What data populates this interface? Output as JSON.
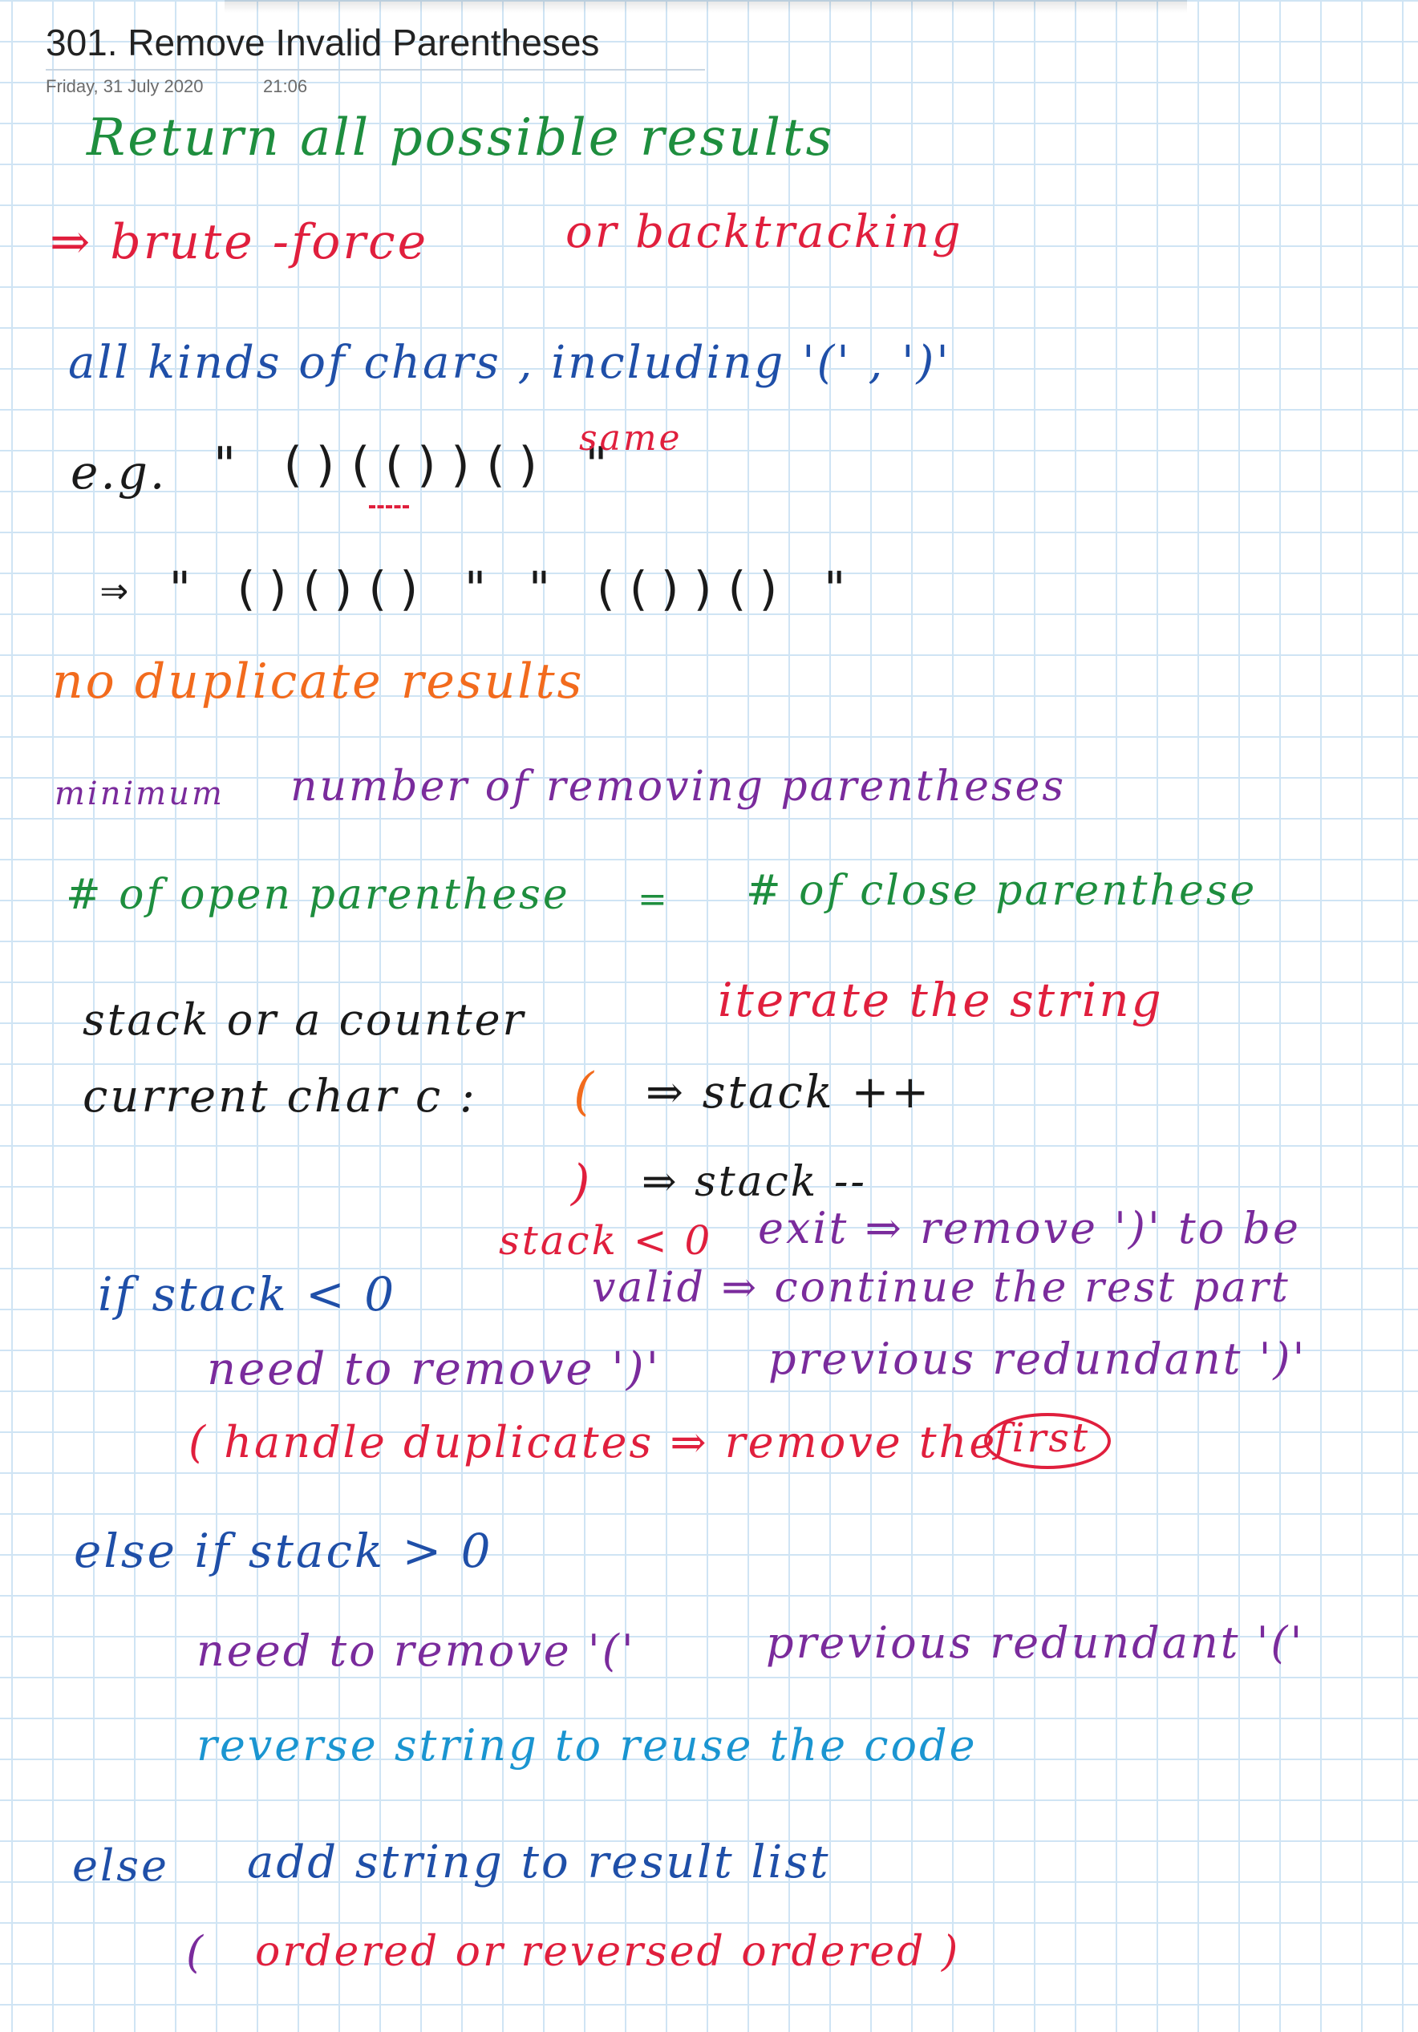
{
  "header": {
    "title": "301. Remove Invalid Parentheses",
    "date": "Friday, 31 July 2020",
    "time": "21:06"
  },
  "notes": {
    "l01": "Return  all  possible  results",
    "l02": "⇒ brute -force",
    "l02b": "or  backtracking",
    "l03": "all  kinds  of  chars , including  '(' , ')'",
    "l04a": "e.g.",
    "l04b": "\" ()(())() \"",
    "l04c": "same",
    "l05a": "⇒  \" ()()() \"",
    "l05b": "\" (())() \"",
    "l06": "no  duplicate  results",
    "l07a": "minimum",
    "l07b": "number  of  removing  parentheses",
    "l08a": "#  of  open  parenthese",
    "l08b": "=",
    "l08c": "# of  close  parenthese",
    "l09a": "stack    or    a    counter",
    "l09b": "iterate  the  string",
    "l10a": "current  char  c :",
    "l10b": "(",
    "l10c": "⇒  stack ++",
    "l11a": ")",
    "l11b": "⇒  stack --",
    "l12a": "stack < 0",
    "l12b": "exit ⇒ remove  ')'  to  be",
    "l13a": "if    stack  < 0",
    "l13b": "valid ⇒ continue  the  rest  part",
    "l14a": "need  to  remove  ')'",
    "l14b": "previous  redundant  ')'",
    "l15": "( handle  duplicates ⇒ remove  the",
    "l15b": "first",
    "l16": "else  if   stack  > 0",
    "l17a": "need  to  remove  '('",
    "l17b": "previous  redundant  '('",
    "l18": "reverse   string  to   reuse  the  code",
    "l19a": "else",
    "l19b": "add   string  to  result  list",
    "l20a": "(",
    "l20b": "ordered  or  reversed  ordered )"
  }
}
